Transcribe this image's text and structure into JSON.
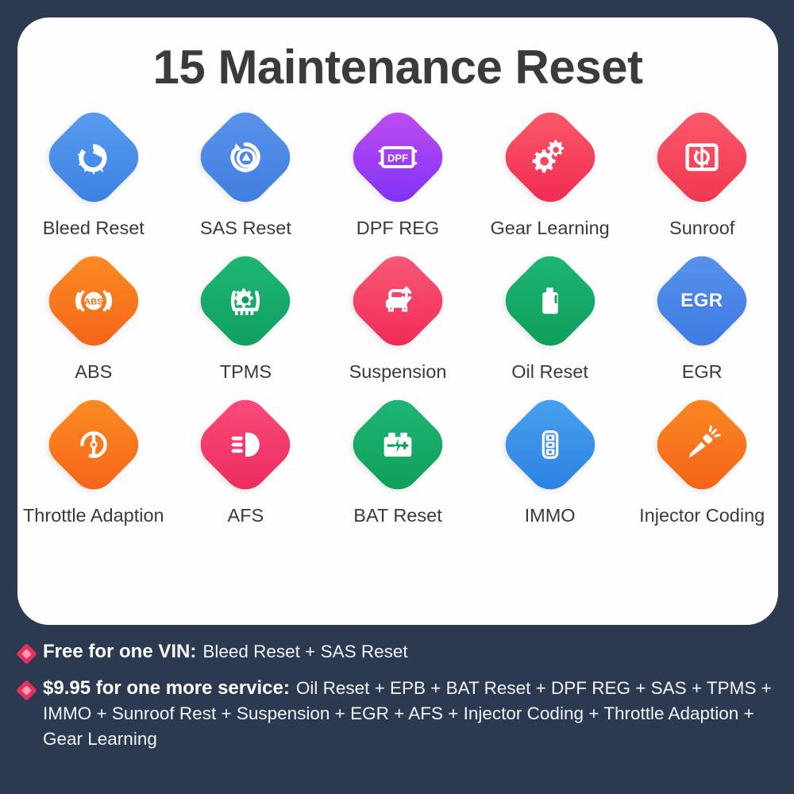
{
  "background_color": "#2b3a50",
  "card": {
    "background_color": "#fefefe",
    "title": "15 Maintenance Reset"
  },
  "grid": {
    "columns": 5,
    "rows": 3,
    "items": [
      {
        "label": "Bleed Reset",
        "icon": "brake-disc-icon",
        "color_start": "#5a9ef0",
        "color_end": "#3a7fe0"
      },
      {
        "label": "SAS Reset",
        "icon": "steering-reset-icon",
        "color_start": "#5b93ec",
        "color_end": "#3f7ddd"
      },
      {
        "label": "DPF REG",
        "icon": "dpf-filter-icon",
        "color_start": "#c44ff0",
        "color_end": "#7b2ff7"
      },
      {
        "label": "Gear Learning",
        "icon": "two-gears-icon",
        "color_start": "#fb5c6c",
        "color_end": "#f0274f"
      },
      {
        "label": "Sunroof",
        "icon": "sunroof-panel-icon",
        "color_start": "#fb5c6c",
        "color_end": "#f0334f"
      },
      {
        "label": "ABS",
        "icon": "abs-brake-icon",
        "color_start": "#fb9021",
        "color_end": "#f5601a"
      },
      {
        "label": "TPMS",
        "icon": "tire-pressure-icon",
        "color_start": "#1fb877",
        "color_end": "#0f9d5c"
      },
      {
        "label": "Suspension",
        "icon": "car-suspension-icon",
        "color_start": "#fb5c7a",
        "color_end": "#ef2752"
      },
      {
        "label": "Oil Reset",
        "icon": "oil-can-icon",
        "color_start": "#1fb877",
        "color_end": "#0d9c58"
      },
      {
        "label": "EGR",
        "icon": "egr-text-icon",
        "color_start": "#5b93ec",
        "color_end": "#3a79e2"
      },
      {
        "label": "Throttle Adaption",
        "icon": "throttle-body-icon",
        "color_start": "#fb9021",
        "color_end": "#f5601a"
      },
      {
        "label": "AFS",
        "icon": "headlight-icon",
        "color_start": "#f94e7e",
        "color_end": "#ea2a5c"
      },
      {
        "label": "BAT Reset",
        "icon": "car-battery-icon",
        "color_start": "#1fb877",
        "color_end": "#0d9c58"
      },
      {
        "label": "IMMO",
        "icon": "car-key-fob-icon",
        "color_start": "#4aa3f0",
        "color_end": "#2a7fe0"
      },
      {
        "label": "Injector Coding",
        "icon": "fuel-injector-icon",
        "color_start": "#fb8b21",
        "color_end": "#f4601a"
      }
    ]
  },
  "footer": {
    "bullet_color": "#e8305f",
    "lines": [
      {
        "label": "Free for one VIN:",
        "value": "Bleed Reset + SAS Reset"
      },
      {
        "label": "$9.95 for one more service:",
        "value": "Oil Reset + EPB + BAT Reset + DPF REG + SAS + TPMS + IMMO + Sunroof Rest + Suspension + EGR + AFS + Injector Coding + Throttle Adaption + Gear Learning"
      }
    ]
  }
}
